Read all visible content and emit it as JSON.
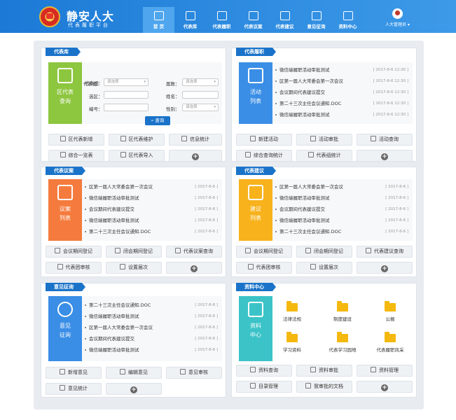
{
  "header": {
    "title": "静安人大",
    "subtitle": "代表履职平台",
    "nav": [
      {
        "label": "首 页",
        "icon": "home-icon"
      },
      {
        "label": "代表库",
        "icon": "document-icon"
      },
      {
        "label": "代表履职",
        "icon": "id-card-icon"
      },
      {
        "label": "代表议案",
        "icon": "clipboard-icon"
      },
      {
        "label": "代表建议",
        "icon": "edit-icon"
      },
      {
        "label": "意见征询",
        "icon": "pen-icon"
      },
      {
        "label": "资料中心",
        "icon": "books-icon"
      }
    ],
    "user": "人大管理员"
  },
  "daibiaoku": {
    "tag": "代表库",
    "block_label_1": "区代表",
    "block_label_2": "查询",
    "fields": {
      "group_label": "代表组：",
      "group_placeholder": "请选择",
      "term_label": "届数：",
      "term_placeholder": "请选择",
      "district_label": "选区：",
      "name_label": "姓名：",
      "number_label": "编号：",
      "gender_label": "性别：",
      "gender_placeholder": "请选择"
    },
    "query_button": "查询",
    "buttons": [
      "区代表新增",
      "区代表维护",
      "信息统计",
      "综合一览表",
      "区代表导入"
    ]
  },
  "lvzhi": {
    "tag": "代表履职",
    "block_label_1": "活动",
    "block_label_2": "列表",
    "items": [
      {
        "text": "微信端履职活动审批测试",
        "date": "[ 2017-8-6 12:30 ]"
      },
      {
        "text": "区第一届人大常委会第一次会议",
        "date": "[ 2017-8-6 12:30 ]"
      },
      {
        "text": "会议期间代表建议提交",
        "date": "[ 2017-8-6 12:30 ]"
      },
      {
        "text": "第二十三次主任会议通知.DOC",
        "date": "[ 2017-8-6 12:30 ]"
      },
      {
        "text": "微信端履职活动审批测试",
        "date": "[ 2017-8-6 12:30 ]"
      }
    ],
    "buttons": [
      "新建活动",
      "活动审批",
      "活动查询",
      "综合查询统计",
      "代表组统计"
    ]
  },
  "yian": {
    "tag": "代表议案",
    "block_label_1": "议案",
    "block_label_2": "列表",
    "items": [
      {
        "text": "区第一届人大常委会第一次会议",
        "date": "[ 2017-8-6 ]"
      },
      {
        "text": "微信端履职活动审批测试",
        "date": "[ 2017-8-6 ]"
      },
      {
        "text": "会议期间代表建议提交",
        "date": "[ 2017-8-6 ]"
      },
      {
        "text": "微信端履职活动审批测试",
        "date": "[ 2017-8-6 ]"
      },
      {
        "text": "第二十三次主任会议通知.DOC",
        "date": "[ 2017-8-6 ]"
      }
    ],
    "buttons": [
      "会议期间登记",
      "闭会期间登记",
      "代表议案查询",
      "代表团审核",
      "设置届次"
    ]
  },
  "jianyi": {
    "tag": "代表建议",
    "block_label_1": "建议",
    "block_label_2": "列表",
    "items": [
      {
        "text": "区第一届人大常委会第一次会议",
        "date": "[ 2017-8-6 ]"
      },
      {
        "text": "微信端履职活动审批测试",
        "date": "[ 2017-8-6 ]"
      },
      {
        "text": "会议期间代表建议提交",
        "date": "[ 2017-8-6 ]"
      },
      {
        "text": "微信端履职活动审批测试",
        "date": "[ 2017-8-6 ]"
      },
      {
        "text": "第二十三次主任会议通知.DOC",
        "date": "[ 2017-8-6 ]"
      }
    ],
    "buttons": [
      "会议期间登记",
      "闭会期间登记",
      "代表建议查询",
      "代表团审核",
      "设置届次"
    ]
  },
  "zhengxun": {
    "tag": "意见征询",
    "block_label_1": "意见",
    "block_label_2": "征询",
    "items": [
      {
        "text": "第二十三次主任会议通知.DOC",
        "date": "[ 2017-8-6 ]"
      },
      {
        "text": "微信端履职活动审批测试",
        "date": "[ 2017-8-6 ]"
      },
      {
        "text": "区第一届人大常委会第一次会议",
        "date": "[ 2017-8-6 ]"
      },
      {
        "text": "会议期间代表建议提交",
        "date": "[ 2017-8-6 ]"
      },
      {
        "text": "微信端履职活动审批测试",
        "date": "[ 2017-8-6 ]"
      }
    ],
    "buttons": [
      "新增意见",
      "编辑意见",
      "意见审核",
      "意见统计"
    ]
  },
  "ziliao": {
    "tag": "资料中心",
    "block_label_1": "资料",
    "block_label_2": "中心",
    "folders": [
      "法律法规",
      "制度建设",
      "公报",
      "学习资料",
      "代表学习园地",
      "代表履职风采"
    ],
    "buttons": [
      "资料查询",
      "资料审批",
      "资料管理",
      "目录管理",
      "我审批的文档"
    ]
  },
  "colors": {
    "header": "#1c7ad6",
    "tag": "#1a73c9",
    "green": "#8dc63f",
    "blue": "#3a8ee6",
    "orange": "#f47b3d",
    "yellow": "#f7b21c",
    "cyan": "#3bc3c8"
  }
}
